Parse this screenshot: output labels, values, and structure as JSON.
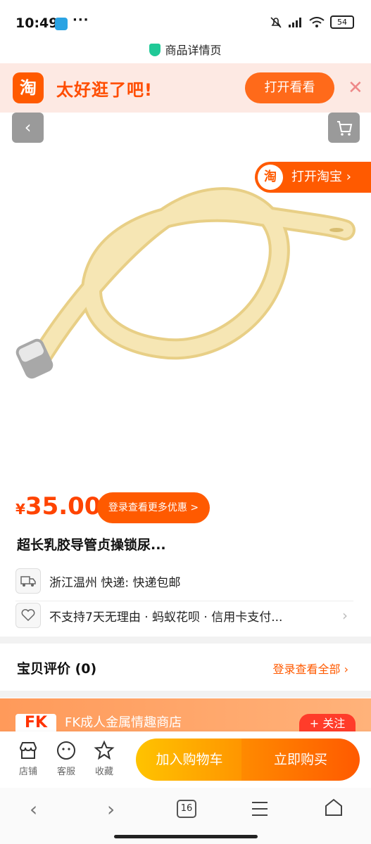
{
  "status_bar": {
    "time": "10:49",
    "more": "···",
    "battery": "54"
  },
  "page_title": "商品详情页",
  "promo_banner": {
    "logo": "淘",
    "slogan": "太好逛了吧!",
    "open_button": "打开看看",
    "close": "✕"
  },
  "nav": {
    "back_icon": "chevron-left-icon",
    "cart_icon": "cart-icon"
  },
  "open_taobao": {
    "logo": "淘",
    "label": "打开淘宝 ›"
  },
  "product": {
    "price_symbol": "¥",
    "price": "35.00",
    "promo_pill": "登录查看更多优惠 >",
    "title": "超长乳胶导管贞操锁尿...",
    "shipping": "浙江温州  快递: 快递包邮",
    "services": "不支持7天无理由 · 蚂蚁花呗 · 信用卡支付..."
  },
  "review": {
    "label": "宝贝评价 (0)",
    "link": "登录查看全部 ›"
  },
  "shop": {
    "logo": "FK",
    "name": "FK成人金属情趣商店",
    "follow": "+ 关注"
  },
  "actions": {
    "store": "店铺",
    "service": "客服",
    "favorite": "收藏",
    "add_cart": "加入购物车",
    "buy_now": "立即购买"
  },
  "browser_nav": {
    "tab_count": "16"
  },
  "colors": {
    "accent": "#ff5a00",
    "promo_bg": "#fde9e3",
    "tube": "#f5e2a8"
  }
}
